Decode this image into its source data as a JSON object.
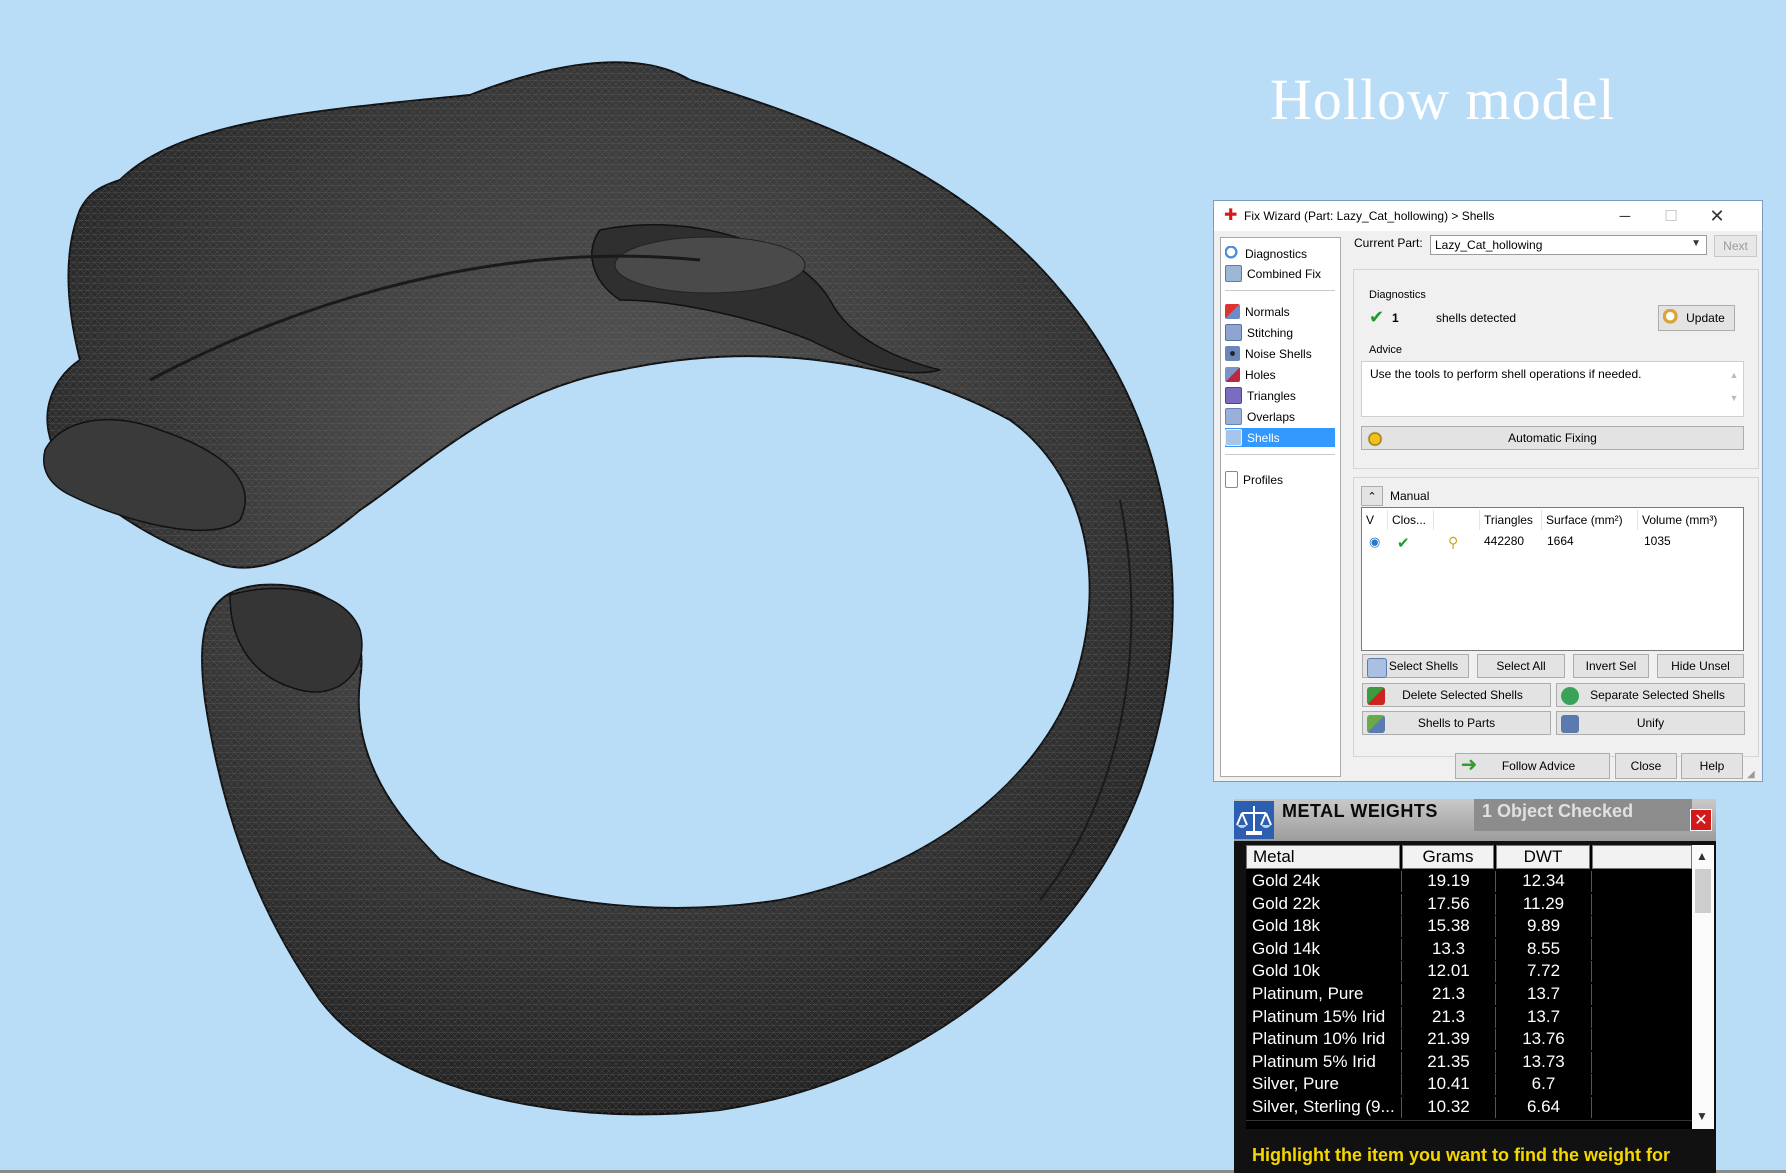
{
  "viewport": {
    "overlay_title": "Hollow model",
    "model_icon": "mesh-ring-model"
  },
  "fix_wizard": {
    "title": "Fix Wizard (Part: Lazy_Cat_hollowing) > Shells",
    "nav": {
      "top": [
        "Diagnostics",
        "Combined Fix"
      ],
      "tools": [
        "Normals",
        "Stitching",
        "Noise Shells",
        "Holes",
        "Triangles",
        "Overlaps",
        "Shells"
      ],
      "bottom": [
        "Profiles"
      ],
      "selected": "Shells"
    },
    "current_part_label": "Current Part:",
    "current_part_value": "Lazy_Cat_hollowing",
    "next_label": "Next",
    "diagnostics": {
      "group_label": "Diagnostics",
      "count": "1",
      "status": "shells detected",
      "update_label": "Update"
    },
    "advice": {
      "group_label": "Advice",
      "text": "Use the tools to perform shell operations if needed."
    },
    "automatic_fixing_label": "Automatic Fixing",
    "manual": {
      "label": "Manual",
      "columns": [
        "V",
        "Clos...",
        "Triangles",
        "Surface (mm²)",
        "Volume (mm³)"
      ],
      "rows": [
        {
          "triangles": "442280",
          "surface": "1664",
          "volume": "1035"
        }
      ]
    },
    "buttons": {
      "select_shells": "Select Shells",
      "select_all": "Select All",
      "invert_sel": "Invert Sel",
      "hide_unsel": "Hide Unsel",
      "delete_selected": "Delete Selected Shells",
      "separate_selected": "Separate Selected Shells",
      "shells_to_parts": "Shells to Parts",
      "unify": "Unify",
      "follow_advice": "Follow Advice",
      "close": "Close",
      "help": "Help"
    }
  },
  "metal_weights": {
    "title": "METAL WEIGHTS",
    "checked": "1 Object Checked",
    "columns": [
      "Metal",
      "Grams",
      "DWT"
    ],
    "rows": [
      {
        "metal": "Gold 24k",
        "grams": "19.19",
        "dwt": "12.34"
      },
      {
        "metal": "Gold 22k",
        "grams": "17.56",
        "dwt": "11.29"
      },
      {
        "metal": "Gold 18k",
        "grams": "15.38",
        "dwt": "9.89"
      },
      {
        "metal": "Gold 14k",
        "grams": "13.3",
        "dwt": "8.55"
      },
      {
        "metal": "Gold 10k",
        "grams": "12.01",
        "dwt": "7.72"
      },
      {
        "metal": "Platinum, Pure",
        "grams": "21.3",
        "dwt": "13.7"
      },
      {
        "metal": "Platinum 15% Irid",
        "grams": "21.3",
        "dwt": "13.7"
      },
      {
        "metal": "Platinum 10% Irid",
        "grams": "21.39",
        "dwt": "13.76"
      },
      {
        "metal": "Platinum 5% Irid",
        "grams": "21.35",
        "dwt": "13.73"
      },
      {
        "metal": "Silver, Pure",
        "grams": "10.41",
        "dwt": "6.7"
      },
      {
        "metal": "Silver, Sterling (9...",
        "grams": "10.32",
        "dwt": "6.64"
      }
    ],
    "footer": "Highlight the item you want to find the weight for"
  },
  "colors": {
    "background": "#b9dcf7",
    "selection": "#3399ff",
    "footer_text": "#f5d700",
    "close_red": "#d11a1a"
  }
}
